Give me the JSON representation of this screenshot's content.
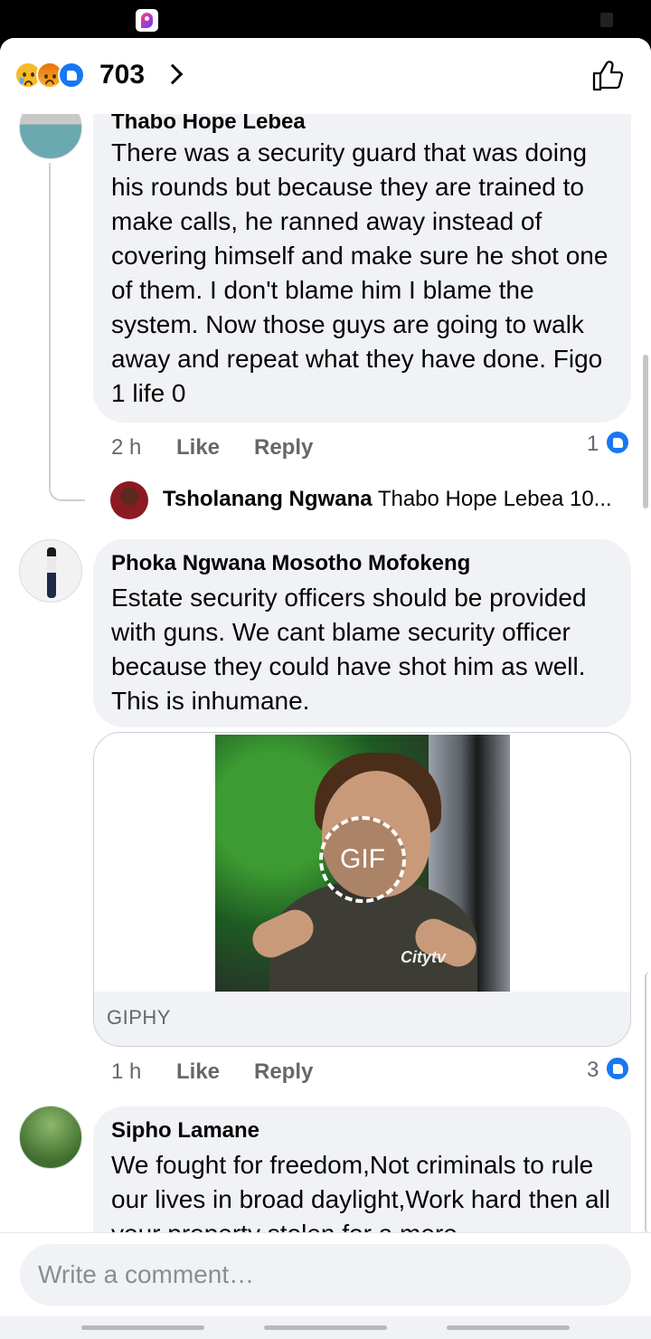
{
  "reactions": {
    "icons": [
      "sad-reaction-icon",
      "angry-reaction-icon",
      "like-reaction-icon"
    ],
    "count": "703"
  },
  "comments": [
    {
      "author": "Thabo Hope Lebea",
      "text": "There was a security guard that was doing his rounds but because they are trained to make calls, he ranned away instead of covering himself and make sure he shot one of them. I don't blame him I blame the system. Now those guys are going to walk away and repeat what they have done. Figo 1 life 0",
      "time": "2 h",
      "like_label": "Like",
      "reply_label": "Reply",
      "like_count": "1"
    },
    {
      "author": "Phoka Ngwana Mosotho Mofokeng",
      "text": "Estate security officers should be provided with guns. We cant blame security officer because they could have shot him as well. This is inhumane.",
      "gif_badge": "GIF",
      "gif_watermark": "Citytv",
      "gif_source": "GIPHY",
      "time": "1 h",
      "like_label": "Like",
      "reply_label": "Reply",
      "like_count": "3"
    },
    {
      "author": "Sipho Lamane",
      "text": "We fought for freedom,Not criminals to rule our lives in broad daylight,Work hard then all your property stolen for a mere"
    }
  ],
  "reply_preview": {
    "author": "Tsholanang Ngwana",
    "text": "Thabo Hope Lebea 10..."
  },
  "composer": {
    "placeholder": "Write a comment…"
  },
  "colors": {
    "accent": "#1877f2",
    "bubble": "#f0f2f5",
    "meta": "#65676b"
  }
}
